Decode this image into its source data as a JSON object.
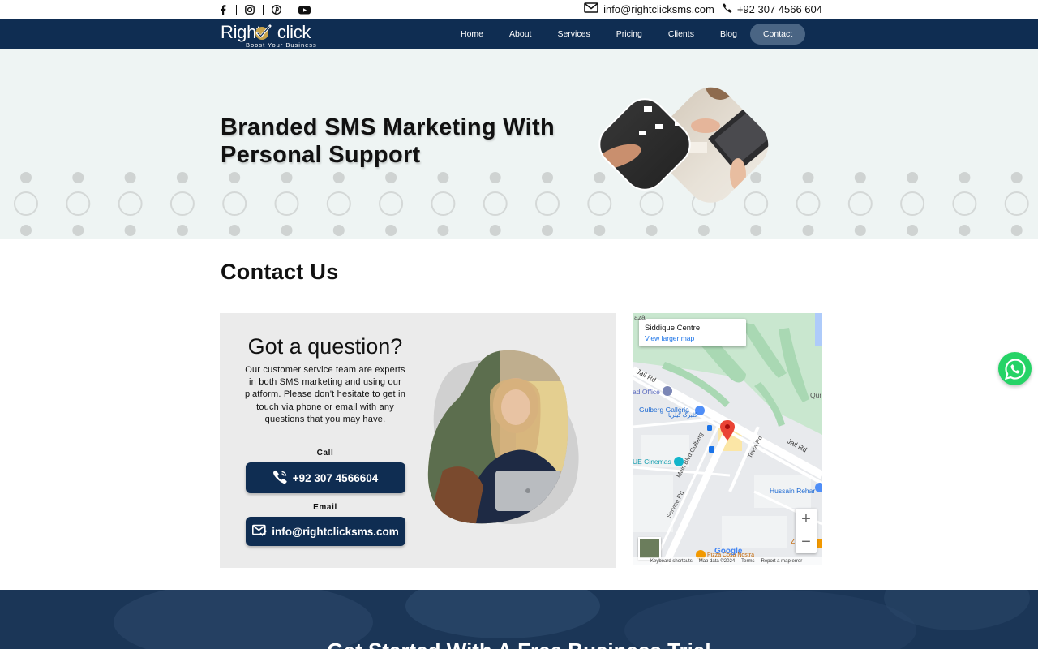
{
  "topbar": {
    "social_icons": [
      "facebook-icon",
      "instagram-icon",
      "pinterest-icon",
      "youtube-icon"
    ],
    "email": "info@rightclicksms.com",
    "phone": "+92 307 4566 604"
  },
  "brand": {
    "name_part1": "Right",
    "name_part2": "click",
    "tagline": "Boost Your Business"
  },
  "nav": {
    "items": [
      {
        "label": "Home"
      },
      {
        "label": "About"
      },
      {
        "label": "Services"
      },
      {
        "label": "Pricing"
      },
      {
        "label": "Clients"
      },
      {
        "label": "Blog"
      },
      {
        "label": "Contact",
        "active": true
      }
    ]
  },
  "hero": {
    "title_line1": "Branded SMS Marketing With",
    "title_line2": "Personal Support"
  },
  "contact": {
    "heading": "Contact Us",
    "card": {
      "title": "Got a question?",
      "body": "Our customer service team are experts in both SMS marketing and using our platform. Please don't hesitate to get in touch via phone or email with any questions that you may have.",
      "call_label": "Call",
      "call_button": "+92 307 4566604",
      "email_label": "Email",
      "email_button": "info@rightclicksms.com"
    }
  },
  "map": {
    "place_title": "Siddique Centre",
    "view_larger": "View larger map",
    "labels": {
      "jail_rd_1": "Jail Rd",
      "jail_rd_2": "Jail Rd",
      "post_office": "ad Office",
      "gulberg_galleria": "Gulberg Galleria",
      "gulberg_galleria_urdu": "گلبرگ گیلریا",
      "cinemas": "UE Cinemas",
      "main_blvd": "Main Blvd Gulberg",
      "service_rd": "Service Rd",
      "tevta_rd": "Tevta Rd",
      "hussain_rehar": "Hussain Rehar",
      "qur": "Qur",
      "z": "Z",
      "top_left": "azà",
      "pizza": "Pizza Cosa Nostra",
      "google": "Google"
    },
    "footer": {
      "shortcuts": "Keyboard shortcuts",
      "map_data": "Map data ©2024",
      "terms": "Terms",
      "report": "Report a map error"
    }
  },
  "cta": {
    "title": "Get Started With A Free Business Trial"
  },
  "colors": {
    "navy": "#0f2d52",
    "nav_active": "#4a6584",
    "hero_bg": "#eef4f3",
    "card_bg": "#ebebeb",
    "whatsapp": "#25d366"
  }
}
